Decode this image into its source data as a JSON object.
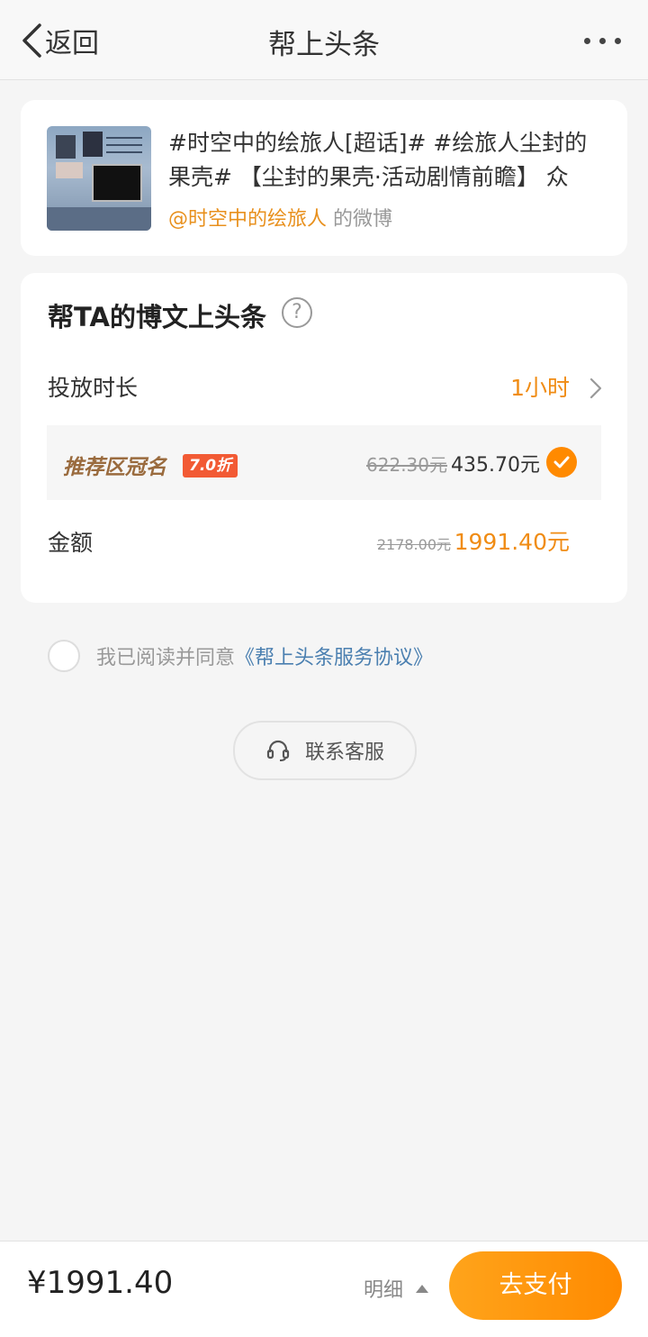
{
  "header": {
    "back_label": "返回",
    "title": "帮上头条"
  },
  "post": {
    "text": "#时空中的绘旅人[超话]# #绘旅人尘封的果壳# 【尘封的果壳·活动剧情前瞻】 众",
    "author": "@时空中的绘旅人",
    "author_suffix": "的微博"
  },
  "promo": {
    "title": "帮TA的博文上头条",
    "help": "?",
    "duration_label": "投放时长",
    "duration_value": "1小时",
    "package": {
      "name": "推荐区冠名",
      "discount": "7.0折",
      "original_price": "622.30元",
      "price": "435.70元",
      "selected": true
    },
    "amount_label": "金额",
    "amount_original": "2178.00元",
    "amount": "1991.40元"
  },
  "agreement": {
    "prefix": "我已阅读并同意",
    "link": "《帮上头条服务协议》",
    "checked": false
  },
  "support": {
    "label": "联系客服"
  },
  "footer": {
    "total": "¥1991.40",
    "detail": "明细",
    "pay": "去支付"
  },
  "colors": {
    "accent": "#f08c14",
    "pay_button": "#ff8a00",
    "badge": "#f25a34",
    "link": "#4a7fb0"
  }
}
